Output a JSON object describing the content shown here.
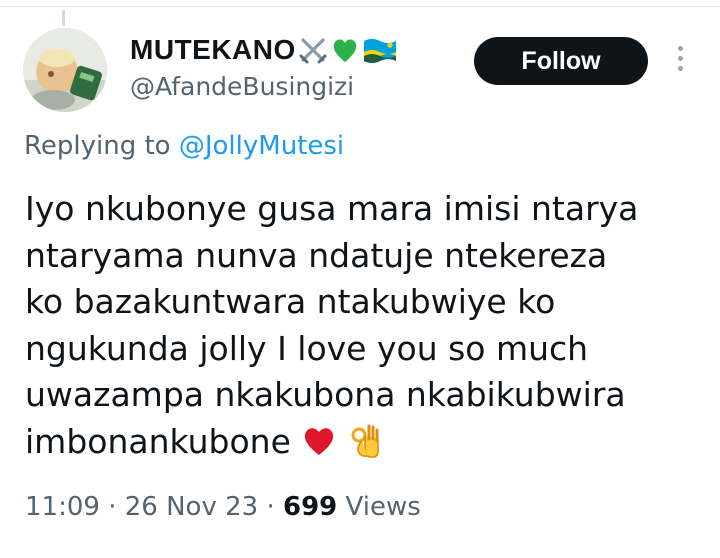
{
  "author": {
    "display_name": "MUTEKANO",
    "name_emojis": [
      "crossed-swords-icon",
      "green-heart-icon",
      "rwanda-flag-icon"
    ],
    "handle": "@AfandeBusingizi"
  },
  "follow_label": "Follow",
  "reply": {
    "prefix": "Replying to",
    "target": "@JollyMutesi"
  },
  "tweet": {
    "lines": [
      "Iyo nkubonye gusa mara imisi ntarya",
      "ntaryama nunva ndatuje ntekereza",
      "ko bazakuntwara ntakubwiye ko",
      "ngukunda jolly I love you so much",
      "uwazampa nkakubona nkabikubwira",
      "imbonankubone"
    ],
    "trailing_emojis": [
      "red-heart-icon",
      "ok-hand-icon"
    ]
  },
  "meta": {
    "time": "11:09",
    "separator": "·",
    "date": "26 Nov 23",
    "views_count": "699",
    "views_label": "Views"
  },
  "colors": {
    "text": "#0f1419",
    "secondary": "#536471",
    "link": "#1d9bf0",
    "button_bg": "#0f1419",
    "button_text": "#ffffff"
  }
}
